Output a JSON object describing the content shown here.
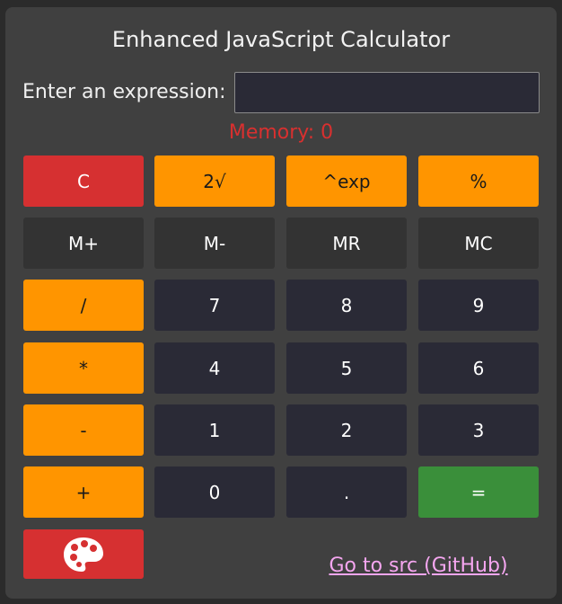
{
  "title": "Enhanced JavaScript Calculator",
  "expression": {
    "label": "Enter an expression:",
    "value": "",
    "placeholder": ""
  },
  "memory_text": "Memory: 0",
  "buttons": [
    {
      "label": "C",
      "color": "#d63031"
    },
    {
      "label": "2√",
      "color": "#ff9500"
    },
    {
      "label": "^exp",
      "color": "#ff9500"
    },
    {
      "label": "%",
      "color": "#ff9500"
    },
    {
      "label": "M+",
      "color": "#333333"
    },
    {
      "label": "M-",
      "color": "#333333"
    },
    {
      "label": "MR",
      "color": "#333333"
    },
    {
      "label": "MC",
      "color": "#333333"
    },
    {
      "label": "/",
      "color": "#ff9500"
    },
    {
      "label": "7",
      "color": "#2a2a36"
    },
    {
      "label": "8",
      "color": "#2a2a36"
    },
    {
      "label": "9",
      "color": "#2a2a36"
    },
    {
      "label": "*",
      "color": "#ff9500"
    },
    {
      "label": "4",
      "color": "#2a2a36"
    },
    {
      "label": "5",
      "color": "#2a2a36"
    },
    {
      "label": "6",
      "color": "#2a2a36"
    },
    {
      "label": "-",
      "color": "#ff9500"
    },
    {
      "label": "1",
      "color": "#2a2a36"
    },
    {
      "label": "2",
      "color": "#2a2a36"
    },
    {
      "label": "3",
      "color": "#2a2a36"
    },
    {
      "label": "+",
      "color": "#ff9500"
    },
    {
      "label": "0",
      "color": "#2a2a36"
    },
    {
      "label": ".",
      "color": "#2a2a36"
    },
    {
      "label": "=",
      "color": "#3a8f3a"
    }
  ],
  "theme_button": {
    "icon": "palette-icon",
    "color": "#d63031"
  },
  "github_link": "Go to src (GitHub)"
}
